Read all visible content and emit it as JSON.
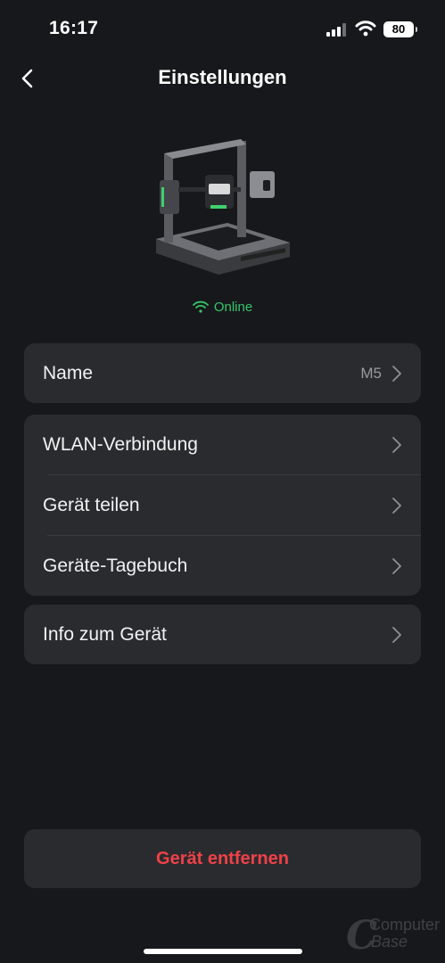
{
  "status_bar": {
    "time": "16:17",
    "battery": "80"
  },
  "header": {
    "title": "Einstellungen"
  },
  "device": {
    "status": "Online",
    "status_color": "#35c66b"
  },
  "settings": {
    "name_label": "Name",
    "name_value": "M5",
    "wlan": "WLAN-Verbindung",
    "share": "Gerät teilen",
    "log": "Geräte-Tagebuch",
    "info": "Info zum Gerät"
  },
  "actions": {
    "remove_label": "Gerät entfernen",
    "remove_color": "#ef4147"
  },
  "watermark": {
    "line1": "Computer",
    "line2": "Base"
  }
}
